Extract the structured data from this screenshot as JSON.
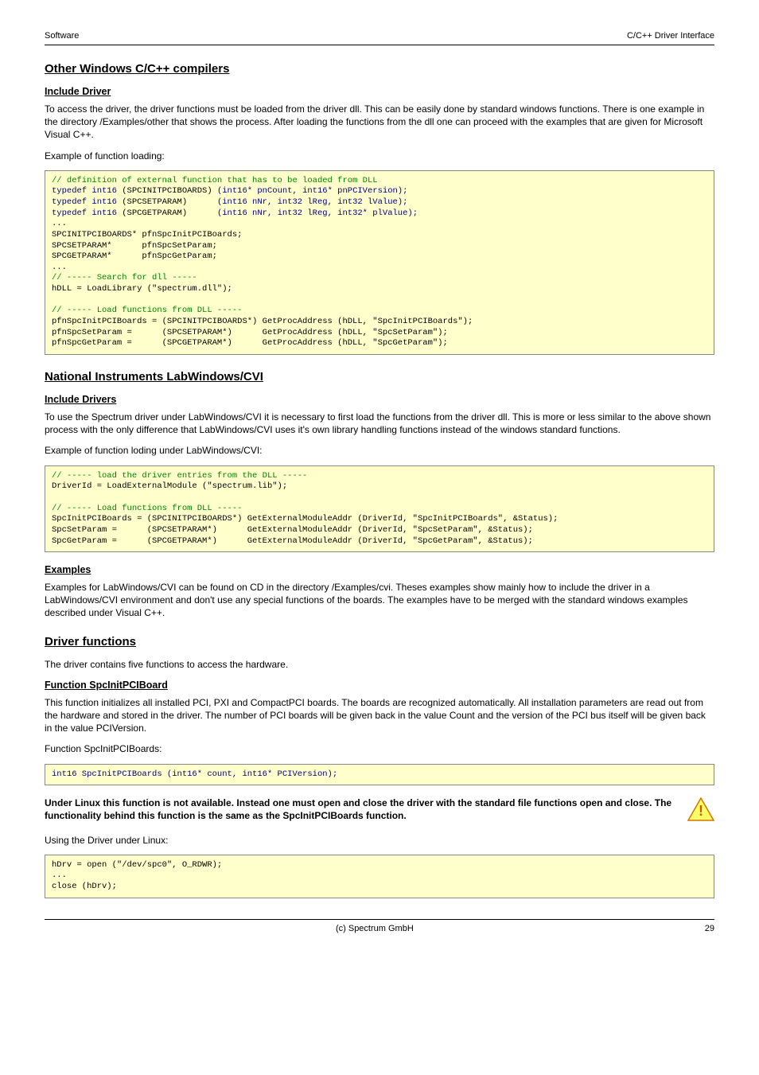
{
  "header": {
    "left": "Software",
    "right": "C/C++ Driver Interface"
  },
  "s1": {
    "title": "Other Windows C/C++ compilers",
    "sub1": "Include Driver",
    "p1": "To access the driver, the driver functions must be loaded from the driver dll. This can be easily done by standard windows functions. There is one example in the directory /Examples/other that shows the process. After loading the functions from the dll one can proceed with the examples that are given for Microsoft Visual C++.",
    "p2": "Example of function loading:",
    "code": {
      "c1": "// definition of external function that has to be loaded from DLL",
      "l1a": "typedef int16 ",
      "l1b": "(SPCINITPCIBOARDS) ",
      "l1c": "(int16* pnCount, int16* pnPCIVersion);",
      "l2a": "typedef int16 ",
      "l2b": "(SPCSETPARAM)      ",
      "l2c": "(int16 nNr, int32 lReg, int32 lValue);",
      "l3a": "typedef int16 ",
      "l3b": "(SPCGETPARAM)      ",
      "l3c": "(int16 nNr, int32 lReg, int32* plValue);",
      "l4": "...",
      "l5": "SPCINITPCIBOARDS* pfnSpcInitPCIBoards;",
      "l6": "SPCSETPARAM*      pfnSpcSetParam;",
      "l7": "SPCGETPARAM*      pfnSpcGetParam;",
      "l8": "...",
      "c2": "// ----- Search for dll -----",
      "l9": "hDLL = LoadLibrary (\"spectrum.dll\");",
      "c3": "// ----- Load functions from DLL -----",
      "l10": "pfnSpcInitPCIBoards = (SPCINITPCIBOARDS*) GetProcAddress (hDLL, \"SpcInitPCIBoards\");",
      "l11": "pfnSpcSetParam =      (SPCSETPARAM*)      GetProcAddress (hDLL, \"SpcSetParam\");",
      "l12": "pfnSpcGetParam =      (SPCGETPARAM*)      GetProcAddress (hDLL, \"SpcGetParam\");"
    }
  },
  "s2": {
    "title": "National Instruments LabWindows/CVI",
    "sub1": "Include Drivers",
    "p1": "To use the Spectrum driver under LabWindows/CVI it is necessary to first load the functions from the driver dll. This is more or less similar to the above shown process with the only difference that LabWindows/CVI uses it's own library handling functions instead of the windows standard functions.",
    "p2": "Example of function loding under LabWindows/CVI:",
    "code": {
      "c1": "// ----- load the driver entries from the DLL -----",
      "l1": "DriverId = LoadExternalModule (\"spectrum.lib\");",
      "c2": "// ----- Load functions from DLL -----",
      "l2": "SpcInitPCIBoards = (SPCINITPCIBOARDS*) GetExternalModuleAddr (DriverId, \"SpcInitPCIBoards\", &Status);",
      "l3": "SpcSetParam =      (SPCSETPARAM*)      GetExternalModuleAddr (DriverId, \"SpcSetParam\", &Status);",
      "l4": "SpcGetParam =      (SPCGETPARAM*)      GetExternalModuleAddr (DriverId, \"SpcGetParam\", &Status);"
    },
    "sub2": "Examples",
    "p3": "Examples for LabWindows/CVI can be found on CD in the directory /Examples/cvi. Theses examples show mainly how to include the driver in a LabWindows/CVI environment and don't use any special functions of the boards. The examples have to be merged with the standard windows examples described under Visual C++."
  },
  "s3": {
    "title": "Driver functions",
    "p1": "The driver contains five functions to access the hardware.",
    "sub1": "Function SpcInitPCIBoard",
    "p2": "This function initializes all installed PCI, PXI and CompactPCI boards. The boards are recognized automatically. All installation parameters are read out from the hardware and stored in the driver. The number of PCI boards will be given back in the value Count and the version of the PCI bus itself will be given back in the value PCIVersion.",
    "p3": "Function SpcInitPCIBoards:",
    "code1": "int16 SpcInitPCIBoards (int16* count, int16* PCIVersion);",
    "warn": "Under Linux this function is not available. Instead one must open and close the driver with the standard file functions open and close. The functionality behind this function is the same as the SpcInitPCIBoards function.",
    "p4": "Using the Driver under Linux:",
    "code2": {
      "l1": "hDrv = open (\"/dev/spc0\", O_RDWR);",
      "l2": "...",
      "l3": "close (hDrv);"
    }
  },
  "footer": {
    "center": "(c) Spectrum GmbH",
    "right": "29"
  }
}
